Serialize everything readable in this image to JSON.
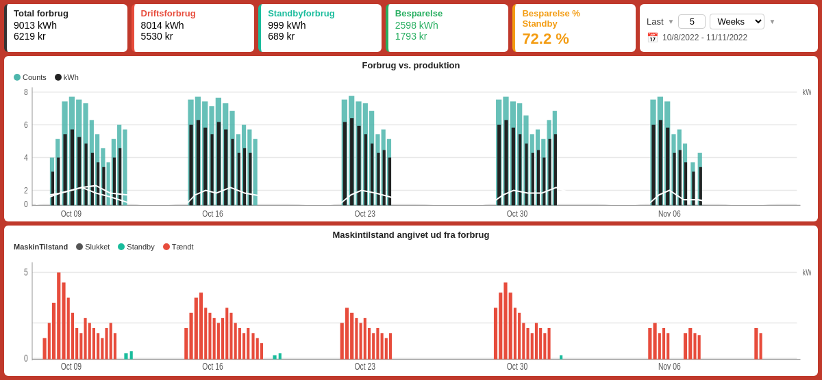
{
  "cards": {
    "total": {
      "title": "Total forbrug",
      "val1": "9013 kWh",
      "val2": "6219 kr"
    },
    "drifts": {
      "title": "Driftsforbrug",
      "val1": "8014 kWh",
      "val2": "5530 kr"
    },
    "standby": {
      "title": "Standbyforbrug",
      "val1": "999 kWh",
      "val2": "689 kr"
    },
    "besparelse": {
      "title": "Besparelse",
      "val1": "2598 kWh",
      "val2": "1793 kr"
    },
    "besparelse_pct": {
      "title": "Besparelse %",
      "subtitle": "Standby",
      "val1": "72.2 %"
    }
  },
  "filter": {
    "label": "Last",
    "value": "5",
    "unit": "Weeks",
    "date_range": "10/8/2022 - 11/11/2022"
  },
  "chart1": {
    "title": "Forbrug vs. produktion",
    "legend": [
      {
        "label": "Counts",
        "color": "#4db6ac"
      },
      {
        "label": "kWh",
        "color": "#222"
      }
    ],
    "x_labels": [
      "Oct 09",
      "Oct 16",
      "Oct 23",
      "Oct 30",
      "Nov 06"
    ],
    "y_labels": [
      "0",
      "2",
      "4",
      "6",
      "8"
    ]
  },
  "chart2": {
    "title": "Maskintilstand angivet ud fra forbrug",
    "legend": [
      {
        "label": "MaskinTilstand",
        "color": "#555"
      },
      {
        "label": "Slukket",
        "color": "#555"
      },
      {
        "label": "Standby",
        "color": "#1abc9c"
      },
      {
        "label": "Tændt",
        "color": "#e74c3c"
      }
    ],
    "x_labels": [
      "Oct 09",
      "Oct 16",
      "Oct 23",
      "Oct 30",
      "Nov 06"
    ],
    "y_labels": [
      "0",
      "5"
    ]
  }
}
